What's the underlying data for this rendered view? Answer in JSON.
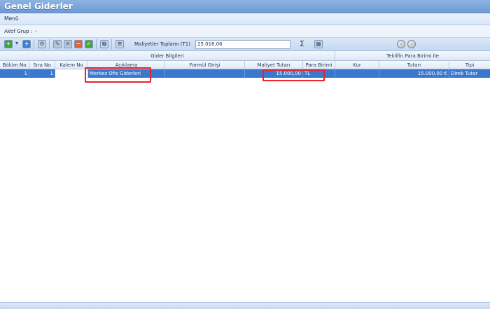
{
  "window": {
    "title": "Genel Giderler"
  },
  "menu": {
    "label": "Menü"
  },
  "group": {
    "label": "Aktif Grup :",
    "value": "-"
  },
  "toolbar": {
    "total_label": "Maliyetler Toplamı (T1)",
    "total_value": "25.018,06",
    "sigma": "Σ"
  },
  "grid": {
    "group_headers": {
      "left": "Gider Bilgileri",
      "right": "Teklifin Para Birimi İle"
    },
    "columns": [
      "Bölüm No",
      "Sıra No",
      "Kalem No",
      "Açıklama",
      "Formül Girişi",
      "Maliyet Tutarı",
      "Para Birimi",
      "Kur",
      "Tutarı",
      "Tipi"
    ],
    "rows": [
      {
        "bolum_no": "1",
        "sira_no": "1",
        "kalem_no": "",
        "aciklama": "Merkez Ofis Giderleri",
        "formul": "",
        "maliyet_tutari": "15.000,00",
        "para_birimi": "TL",
        "kur": "",
        "tutari": "15.000,00 €",
        "tipi": "Direk Tutar"
      }
    ]
  },
  "colors": {
    "selection": "#3a78cf",
    "highlight": "#e8242a",
    "title_bar": "#7fa6db"
  }
}
